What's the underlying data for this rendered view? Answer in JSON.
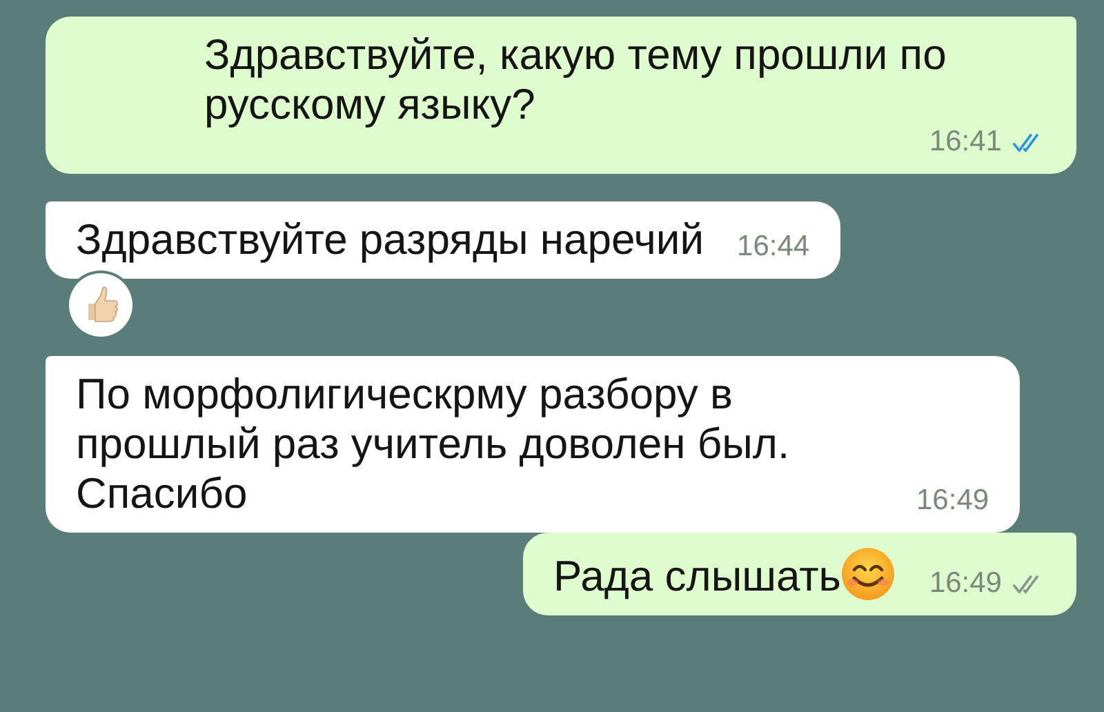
{
  "messages": [
    {
      "kind": "sent",
      "text": "Здравствуйте, какую тему прошли по русскому языку?",
      "time": "16:41",
      "read": true,
      "smiley": false,
      "reaction": false
    },
    {
      "kind": "received",
      "text": "Здравствуйте разряды наречий",
      "time": "16:44",
      "smiley": false,
      "reaction": true
    },
    {
      "kind": "received",
      "text": "По морфолигическрму разбору в прошлый раз учитель доволен был. Спасибо",
      "time": "16:49",
      "smiley": false,
      "reaction": false
    },
    {
      "kind": "sent",
      "text": "Рада слышать",
      "time": "16:49",
      "read": false,
      "smiley": true,
      "reaction": false
    }
  ]
}
